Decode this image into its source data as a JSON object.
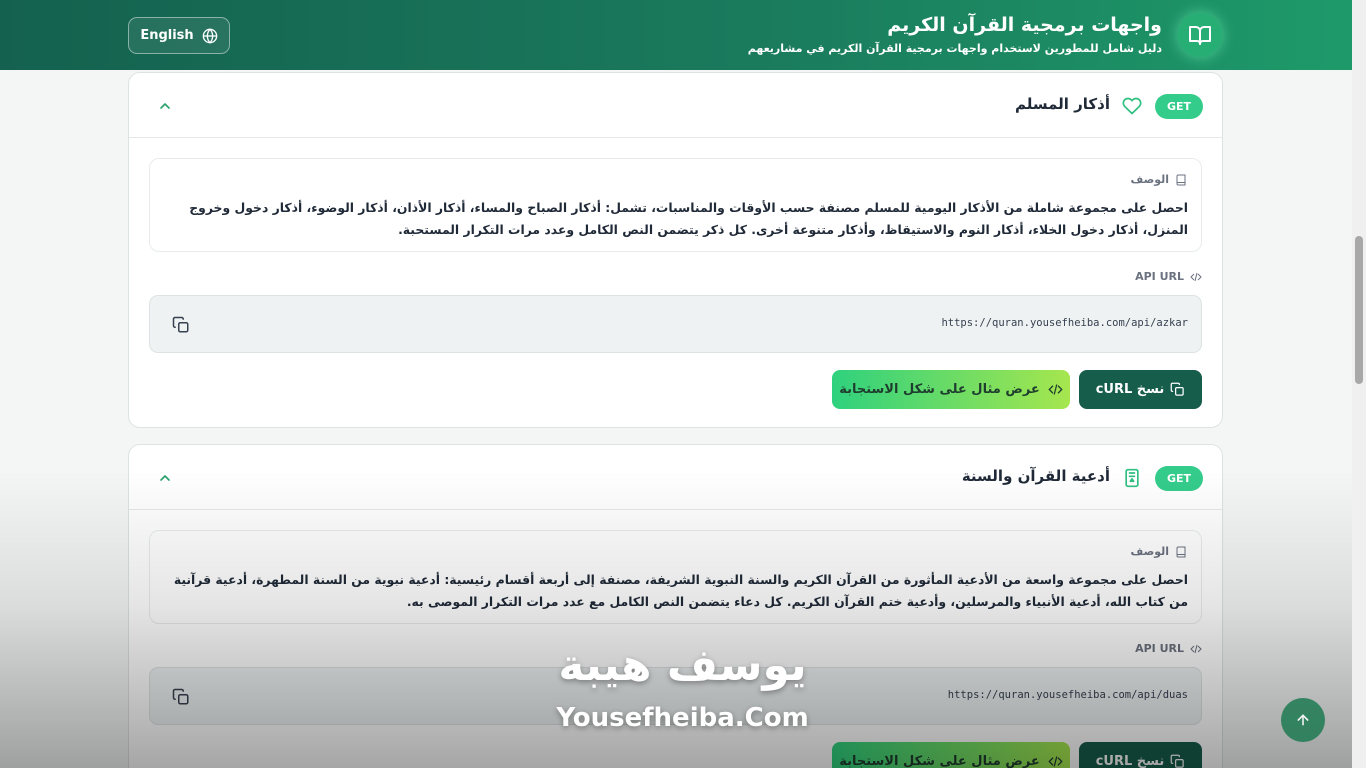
{
  "header": {
    "title": "واجهات برمجية القرآن الكريم",
    "subtitle": "دليل شامل للمطورين لاستخدام واجهات برمجية القرآن الكريم في مشاريعهم",
    "language_button": "English",
    "logo_icon": "open-book-icon"
  },
  "cards": [
    {
      "method": "GET",
      "title": "أذكار المسلم",
      "icon": "heart-icon",
      "description_label": "الوصف",
      "description": "احصل على مجموعة شاملة من الأذكار اليومية للمسلم مصنفة حسب الأوقات والمناسبات، تشمل: أذكار الصباح والمساء، أذكار الأذان، أذكار الوضوء، أذكار دخول وخروج المنزل، أذكار دخول الخلاء، أذكار النوم والاستيقاظ، وأذكار متنوعة أخرى. كل ذكر يتضمن النص الكامل وعدد مرات التكرار المستحبة.",
      "api_label": "API URL",
      "api_url": "https://quran.yousefheiba.com/api/azkar",
      "curl_button": "نسخ cURL",
      "example_button": "عرض مثال على شكل الاستجابة"
    },
    {
      "method": "GET",
      "title": "أدعية القرآن والسنة",
      "icon": "book-bookmark-icon",
      "description_label": "الوصف",
      "description": "احصل على مجموعة واسعة من الأدعية المأثورة من القرآن الكريم والسنة النبوية الشريفة، مصنفة إلى أربعة أقسام رئيسية: أدعية نبوية من السنة المطهرة، أدعية قرآنية من كتاب الله، أدعية الأنبياء والمرسلين، وأدعية ختم القرآن الكريم. كل دعاء يتضمن النص الكامل مع عدد مرات التكرار الموصى به.",
      "api_label": "API URL",
      "api_url": "https://quran.yousefheiba.com/api/duas",
      "curl_button": "نسخ cURL",
      "example_button": "عرض مثال على شكل الاستجابة"
    }
  ],
  "watermark": {
    "arabic": "يوسف هيبة",
    "latin": "Yousefheiba.Com"
  },
  "colors": {
    "header_start": "#14614f",
    "header_end": "#1e9a6a",
    "get_badge": "#34cc8b",
    "curl_button": "#165d4b",
    "example_start": "#2fd17e",
    "example_end": "#a6e64e"
  }
}
